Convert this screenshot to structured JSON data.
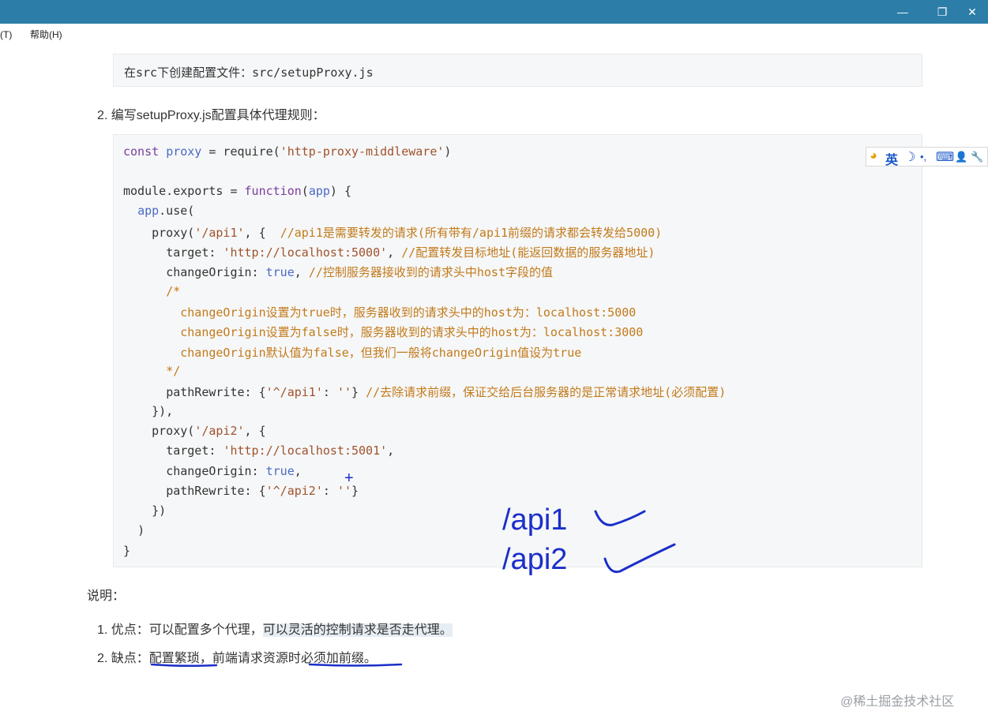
{
  "window": {
    "minimize_icon": "—",
    "restore_icon": "❐",
    "close_icon": "✕"
  },
  "menu": {
    "partial_item": "题(T)",
    "help": "帮助(H)"
  },
  "step1_code": "在src下创建配置文件：src/setupProxy.js",
  "step2_label": "2. 编写setupProxy.js配置具体代理规则：",
  "code": {
    "l1_const": "const",
    "l1_proxy": "proxy",
    "l1_eq": " = require(",
    "l1_str": "'http-proxy-middleware'",
    "l1_end": ")",
    "l2_module": "module.exports = ",
    "l2_function": "function",
    "l2_lp": "(",
    "l2_app": "app",
    "l2_end": ") {",
    "l3_app": "app",
    "l3_use": ".use(",
    "l4_proxy": "proxy(",
    "l4_str": "'/api1'",
    "l4_mid": ", {  ",
    "l4_cm": "//api1是需要转发的请求(所有带有/api1前缀的请求都会转发给5000)",
    "l5_key": "target: ",
    "l5_str": "'http://localhost:5000'",
    "l5_mid": ", ",
    "l5_cm": "//配置转发目标地址(能返回数据的服务器地址)",
    "l6_key": "changeOrigin: ",
    "l6_val": "true",
    "l6_mid": ", ",
    "l6_cm": "//控制服务器接收到的请求头中host字段的值",
    "l7_cm": "/*",
    "l8_cm": "changeOrigin设置为true时，服务器收到的请求头中的host为：localhost:5000",
    "l9_cm": "changeOrigin设置为false时，服务器收到的请求头中的host为：localhost:3000",
    "l10_cm": "changeOrigin默认值为false，但我们一般将changeOrigin值设为true",
    "l11_cm": "*/",
    "l12_key": "pathRewrite: {",
    "l12_str1": "'^/api1'",
    "l12_colon": ": ",
    "l12_str2": "''",
    "l12_end": "} ",
    "l12_cm": "//去除请求前缀，保证交给后台服务器的是正常请求地址(必须配置)",
    "l13": "}),",
    "l14_proxy": "proxy(",
    "l14_str": "'/api2'",
    "l14_end": ", {",
    "l15_key": "target: ",
    "l15_str": "'http://localhost:5001'",
    "l15_end": ",",
    "l16_key": "changeOrigin: ",
    "l16_val": "true",
    "l16_end": ",",
    "l17_key": "pathRewrite: {",
    "l17_str1": "'^/api2'",
    "l17_colon": ": ",
    "l17_str2": "''",
    "l17_end": "}",
    "l18": "})",
    "l19": ")",
    "l20": "}"
  },
  "ime": {
    "logo_icon": "◕",
    "lang": "英",
    "moon_icon": "☽",
    "punct_icon": "•,",
    "keyboard_icon": "⌨",
    "user_icon": "👤",
    "wrench_icon": "🔧"
  },
  "handwriting": {
    "api1": "/api1",
    "api2": "/api2",
    "cursor_plus": "+"
  },
  "notes_title": "说明：",
  "notes": {
    "item1_prefix": "1. 优点：可以配置多个代理，",
    "item1_highlight": "可以灵活的控制请求是否走代理。",
    "item2_prefix": "2. 缺点：",
    "item2_part1": "配置繁琐",
    "item2_part2": "，前端请求资源",
    "item2_part3": "时必须加前缀。"
  },
  "watermark": "@稀土掘金技术社区"
}
